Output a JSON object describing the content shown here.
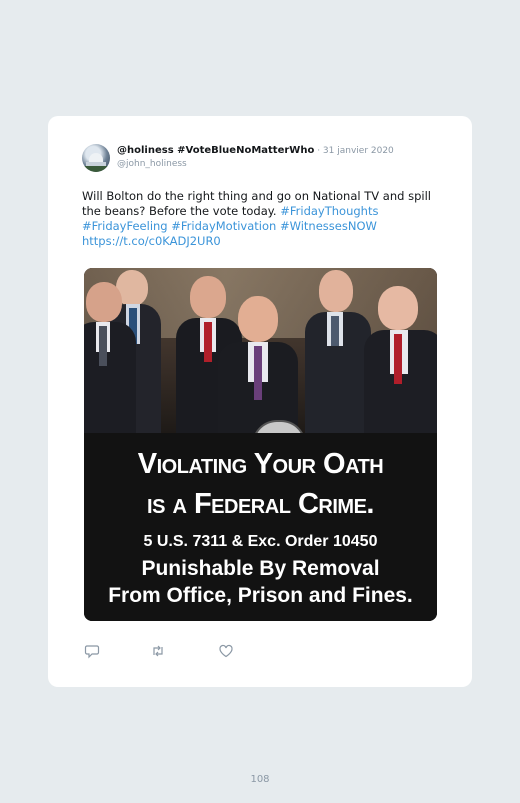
{
  "tweet": {
    "display_name": "@holiness #VoteBlueNoMatterWho",
    "separator": " · ",
    "date": "31 janvier 2020",
    "handle": "@john_holiness",
    "text_plain": "Will Bolton do the right thing and go on National TV and spill the beans? Before the vote today. ",
    "links": [
      "#FridayThoughts",
      "#FridayFeeling",
      "#FridayMotivation",
      "#WitnessesNOW",
      "https://t.co/c0KADJ2UR0"
    ],
    "link_color": "#3b94d9"
  },
  "media": {
    "slogan_line1": "Violating Your Oath",
    "slogan_line2": "is a Federal Crime.",
    "slogan_line3": "5 U.S. 7311 & Exc. Order 10450",
    "slogan_line4": "Punishable By Removal",
    "slogan_line5": "From Office, Prison and Fines."
  },
  "actions": {
    "icons": [
      "reply-icon",
      "retweet-icon",
      "like-icon"
    ]
  },
  "page": {
    "number": "108"
  }
}
